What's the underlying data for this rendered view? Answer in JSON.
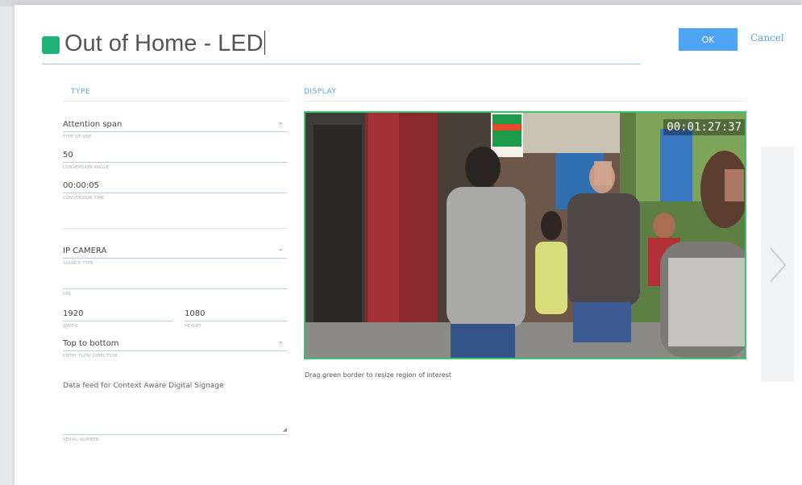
{
  "dialog": {
    "title": "Out of Home - LED",
    "ok_label": "OK",
    "cancel_label": "Cancel",
    "accent_color": "#1fb37a"
  },
  "type_section": {
    "heading": "TYPE",
    "type_of_use": {
      "value": "Attention span",
      "hint": "TYPE OF USE"
    },
    "conversion_angle": {
      "value": "50",
      "hint": "CONVERSION ANGLE"
    },
    "conversion_time": {
      "value": "00:00:05",
      "hint": "CONVERSION TIME"
    },
    "source_type": {
      "value": "IP CAMERA",
      "hint": "SOURCE TYPE"
    },
    "url": {
      "value": "",
      "hint": "URL"
    },
    "width": {
      "value": "1920",
      "hint": "WIDTH"
    },
    "height": {
      "value": "1080",
      "hint": "HEIGHT"
    },
    "entry_flow_direction": {
      "value": "Top to bottom",
      "hint": "ENTRY FLOW DIRECTION"
    },
    "serial_number": {
      "value": "Data feed for Context Aware Digital Signage",
      "hint": "SERIAL NUMBER"
    }
  },
  "display_section": {
    "heading": "DISPLAY",
    "timestamp": "00:01:27:37",
    "caption": "Drag green border to resize region of interest",
    "border_color": "#3cc36b"
  },
  "icons": [
    "chevron-down-icon",
    "chevron-right-icon",
    "resize-grip-icon"
  ]
}
